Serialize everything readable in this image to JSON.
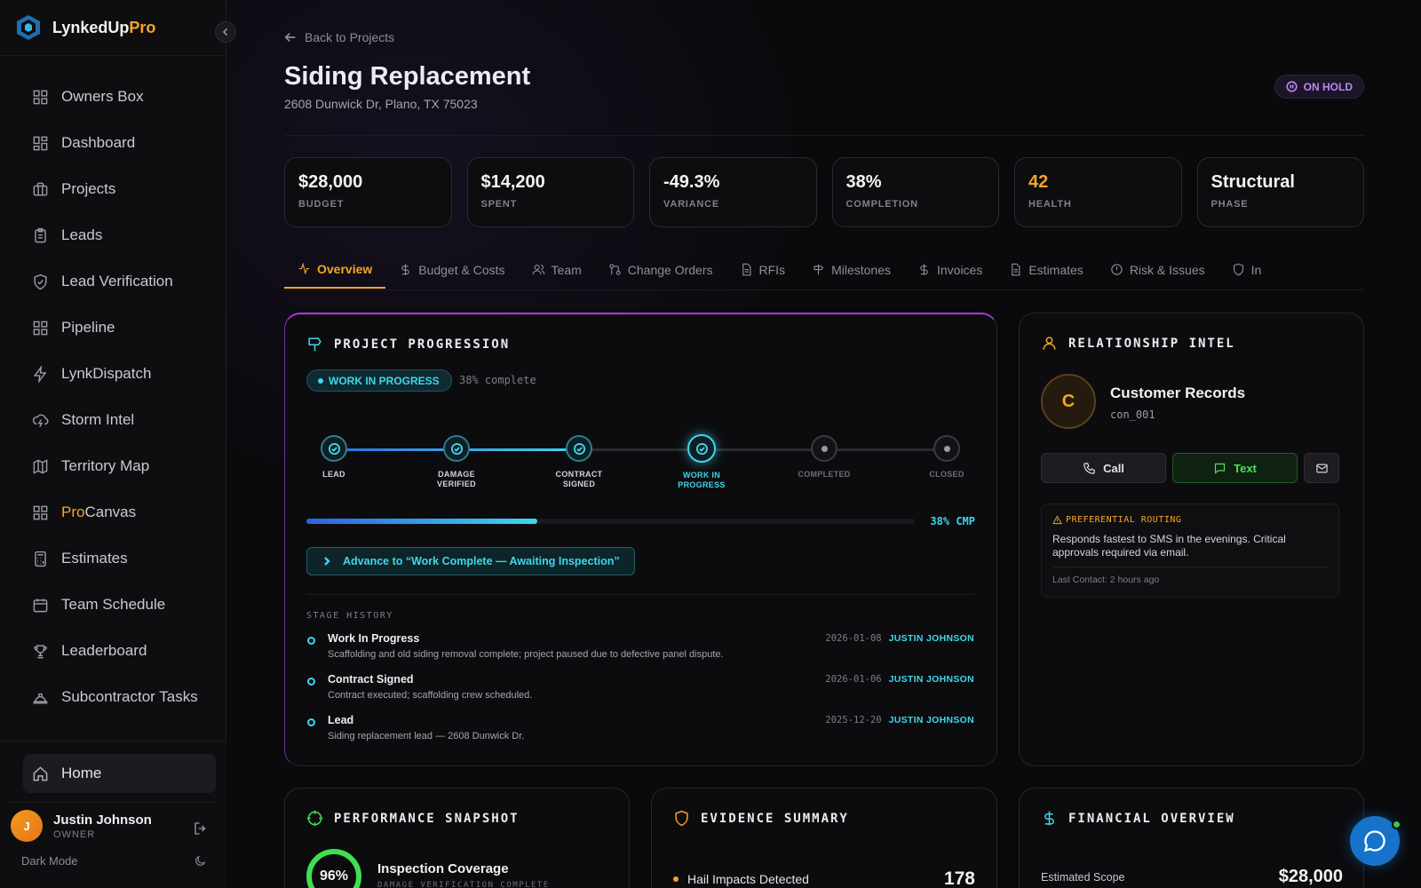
{
  "brand": {
    "name_main": "LynkedUp",
    "name_accent": "Pro"
  },
  "sidebar": {
    "items": [
      {
        "label": "Owners Box",
        "icon": "grid-icon"
      },
      {
        "label": "Dashboard",
        "icon": "grid-icon"
      },
      {
        "label": "Projects",
        "icon": "briefcase-icon"
      },
      {
        "label": "Leads",
        "icon": "clipboard-icon"
      },
      {
        "label": "Lead Verification",
        "icon": "shield-check-icon"
      },
      {
        "label": "Pipeline",
        "icon": "grid-icon"
      },
      {
        "label": "LynkDispatch",
        "icon": "bolt-icon"
      },
      {
        "label": "Storm Intel",
        "icon": "cloud-lightning-icon"
      },
      {
        "label": "Territory Map",
        "icon": "map-icon"
      },
      {
        "label_accent": "Pro",
        "label_rest": "Canvas",
        "icon": "grid-icon"
      },
      {
        "label": "Estimates",
        "icon": "calculator-icon"
      },
      {
        "label": "Team Schedule",
        "icon": "calendar-icon"
      },
      {
        "label": "Leaderboard",
        "icon": "trophy-icon"
      },
      {
        "label": "Subcontractor Tasks",
        "icon": "hard-hat-icon"
      }
    ],
    "home_label": "Home",
    "user": {
      "initial": "J",
      "name": "Justin Johnson",
      "role": "OWNER"
    },
    "dark_mode_label": "Dark Mode"
  },
  "page": {
    "back_label": "Back to Projects",
    "title": "Siding Replacement",
    "address": "2608 Dunwick Dr, Plano, TX 75023",
    "status": "ON HOLD",
    "status_color": "#b88af0"
  },
  "kpis": [
    {
      "value": "$28,000",
      "label": "BUDGET"
    },
    {
      "value": "$14,200",
      "label": "SPENT"
    },
    {
      "value": "-49.3%",
      "label": "VARIANCE"
    },
    {
      "value": "38%",
      "label": "COMPLETION"
    },
    {
      "value": "42",
      "label": "HEALTH"
    },
    {
      "value": "Structural",
      "label": "PHASE"
    }
  ],
  "tabs": [
    {
      "label": "Overview",
      "icon": "activity-icon"
    },
    {
      "label": "Budget & Costs",
      "icon": "dollar-icon"
    },
    {
      "label": "Team",
      "icon": "users-icon"
    },
    {
      "label": "Change Orders",
      "icon": "git-branch-icon"
    },
    {
      "label": "RFIs",
      "icon": "file-icon"
    },
    {
      "label": "Milestones",
      "icon": "signpost-icon"
    },
    {
      "label": "Invoices",
      "icon": "dollar-icon"
    },
    {
      "label": "Estimates",
      "icon": "file-icon"
    },
    {
      "label": "Risk & Issues",
      "icon": "alert-circle-icon"
    },
    {
      "label": "In",
      "icon": "shield-icon"
    }
  ],
  "progression": {
    "title": "PROJECT PROGRESSION",
    "status_pill": "WORK IN PROGRESS",
    "complete_text": "38% complete",
    "progress_fraction": 0.38,
    "progress_label": "38% CMP",
    "stages": [
      {
        "line1": "LEAD",
        "line2": "",
        "state": "done"
      },
      {
        "line1": "DAMAGE",
        "line2": "VERIFIED",
        "state": "done"
      },
      {
        "line1": "CONTRACT",
        "line2": "SIGNED",
        "state": "done"
      },
      {
        "line1": "WORK IN",
        "line2": "PROGRESS",
        "state": "current"
      },
      {
        "line1": "COMPLETED",
        "line2": "",
        "state": "future"
      },
      {
        "line1": "CLOSED",
        "line2": "",
        "state": "future"
      }
    ],
    "advance_label": "Advance to “Work Complete — Awaiting Inspection”",
    "history_label": "STAGE HISTORY",
    "history": [
      {
        "title": "Work In Progress",
        "desc": "Scaffolding and old siding removal complete; project paused due to defective panel dispute.",
        "date": "2026-01-08",
        "user": "JUSTIN JOHNSON"
      },
      {
        "title": "Contract Signed",
        "desc": "Contract executed; scaffolding crew scheduled.",
        "date": "2026-01-06",
        "user": "JUSTIN JOHNSON"
      },
      {
        "title": "Lead",
        "desc": "Siding replacement lead — 2608 Dunwick Dr.",
        "date": "2025-12-20",
        "user": "JUSTIN JOHNSON"
      }
    ]
  },
  "relationship": {
    "title": "RELATIONSHIP INTEL",
    "initial": "C",
    "name": "Customer Records",
    "id": "con_001",
    "call_label": "Call",
    "text_label": "Text",
    "routing_title": "PREFERENTIAL ROUTING",
    "routing_text": "Responds fastest to SMS in the evenings. Critical approvals required via email.",
    "last_contact": "Last Contact: 2 hours ago"
  },
  "performance": {
    "title": "PERFORMANCE SNAPSHOT",
    "ring_value": "96%",
    "item_title": "Inspection Coverage",
    "item_sub": "DAMAGE VERIFICATION COMPLETE"
  },
  "evidence": {
    "title": "EVIDENCE SUMMARY",
    "item_label": "Hail Impacts Detected",
    "item_value": "178"
  },
  "financial": {
    "title": "FINANCIAL OVERVIEW",
    "item_label": "Estimated Scope",
    "item_value": "$28,000"
  },
  "colors": {
    "accent": "#f5a524",
    "cyan": "#3fd6ec",
    "green": "#4ee05c"
  }
}
